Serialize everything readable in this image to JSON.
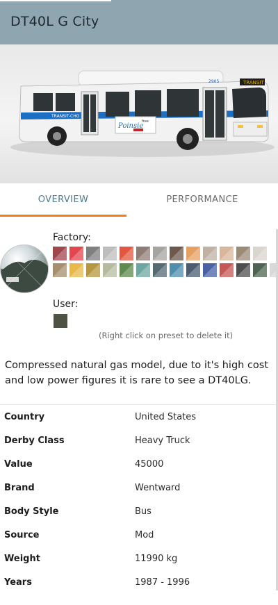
{
  "header": {
    "title": "DT40L G City"
  },
  "hero": {
    "bus_number": "2905",
    "route_sign": "TRANSIT",
    "side_text": "TRANSIT-CHG",
    "ad_brand": "Poinsie",
    "ad_text": "free"
  },
  "tabs": [
    {
      "label": "OVERVIEW",
      "active": true
    },
    {
      "label": "PERFORMANCE",
      "active": false
    }
  ],
  "paint": {
    "factory_label": "Factory:",
    "user_label": "User:",
    "hint": "(Right click on preset to delete it)",
    "factory_colors_row1": [
      "#a0464d",
      "#e0474f",
      "#7f7f7f",
      "#bdbdbd",
      "#e2573f",
      "#8f7c74",
      "#a7a4a0",
      "#6e5a4d",
      "#e6a062",
      "#bfb2a5",
      "#d8b69b",
      "#9c8a78",
      "#dad6cf"
    ],
    "factory_colors_row2": [
      "#a58f6d",
      "#e6b94a",
      "#b6963e",
      "#b6bba0",
      "#5e8a4e",
      "#6ea7a2",
      "#566a74",
      "#4f8ead",
      "#4b5c73",
      "#4a62a5",
      "#c45857",
      "#4f4f4f",
      "#4e6450",
      "#d8d8d8"
    ],
    "user_colors": [
      "#4d5243"
    ]
  },
  "description": "Compressed natural gas model, due to it's high cost and low power figures it is rare to see a DT40LG.",
  "stats": [
    {
      "key": "Country",
      "value": "United States"
    },
    {
      "key": "Derby Class",
      "value": "Heavy Truck"
    },
    {
      "key": "Value",
      "value": "45000"
    },
    {
      "key": "Brand",
      "value": "Wentward"
    },
    {
      "key": "Body Style",
      "value": "Bus"
    },
    {
      "key": "Source",
      "value": "Mod"
    },
    {
      "key": "Weight",
      "value": "11990 kg"
    },
    {
      "key": "Years",
      "value": "1987 - 1996"
    }
  ]
}
